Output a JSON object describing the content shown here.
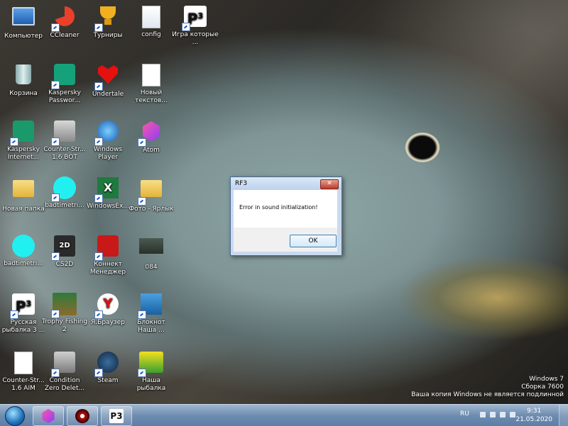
{
  "desktop_icons": [
    {
      "label": "Компьютер",
      "icon": "computer-icon"
    },
    {
      "label": "CCleaner",
      "icon": "ccleaner-icon"
    },
    {
      "label": "Турниры",
      "icon": "trophy-icon"
    },
    {
      "label": "config",
      "icon": "config-file-icon"
    },
    {
      "label": "Игра которые ...",
      "icon": "p3-game-icon"
    },
    {
      "label": "Корзина",
      "icon": "recycle-bin-icon"
    },
    {
      "label": "Kaspersky Passwor...",
      "icon": "kaspersky-password-icon"
    },
    {
      "label": "Undertale",
      "icon": "undertale-heart-icon"
    },
    {
      "label": "Новый текстов...",
      "icon": "text-document-icon"
    },
    {
      "label": "Kaspersky Internet...",
      "icon": "kaspersky-internet-icon"
    },
    {
      "label": "Counter-Str... 1.6 BOT",
      "icon": "counter-strike-icon"
    },
    {
      "label": "Windows Player",
      "icon": "windows-player-icon"
    },
    {
      "label": "Atom",
      "icon": "atom-icon"
    },
    {
      "label": "Новая папка",
      "icon": "folder-icon"
    },
    {
      "label": "badtimetri...",
      "icon": "cyan-circle-icon"
    },
    {
      "label": "WindowsEx...",
      "icon": "excel-icon"
    },
    {
      "label": "Фото - Ярлык",
      "icon": "photo-folder-icon"
    },
    {
      "label": "badtimetri...",
      "icon": "cyan-circle-icon"
    },
    {
      "label": "CS2D",
      "icon": "cs2d-icon"
    },
    {
      "label": "Коннект Менеджер",
      "icon": "connect-manager-icon"
    },
    {
      "label": "084",
      "icon": "fish-photo-icon"
    },
    {
      "label": "Русская рыбалка 3 ...",
      "icon": "p3-game-icon"
    },
    {
      "label": "Trophy Fishing 2",
      "icon": "trophy-fishing-icon"
    },
    {
      "label": "Я.Браузер",
      "icon": "yandex-browser-icon"
    },
    {
      "label": "Блокнот Наша ...",
      "icon": "notepad-icon"
    },
    {
      "label": "Counter-Str... 1.6 AIM",
      "icon": "blank-file-icon"
    },
    {
      "label": "Condition Zero Delet...",
      "icon": "condition-zero-icon"
    },
    {
      "label": "Steam",
      "icon": "steam-icon"
    },
    {
      "label": "Наша рыбалка",
      "icon": "nasha-rybalka-icon"
    }
  ],
  "dialog": {
    "title": "RF3",
    "close_label": "✕",
    "message": "Error in sound initialization!",
    "ok_label": "OK"
  },
  "watermark": {
    "line1": "Windows 7",
    "line2": "Сборка 7600",
    "line3": "Ваша копия Windows не является подлинной"
  },
  "taskbar": {
    "pinned": [
      {
        "name": "atom",
        "icon": "atom-icon"
      },
      {
        "name": "media-player",
        "icon": "media-player-icon"
      },
      {
        "name": "rf3",
        "icon": "p3-game-icon"
      }
    ],
    "lang": "RU",
    "time": "9:31",
    "date": "21.05.2020"
  },
  "colors": {
    "taskbar": "#6f8db0",
    "dialog_frame": "#c9daf0",
    "close_button": "#c0392b"
  }
}
